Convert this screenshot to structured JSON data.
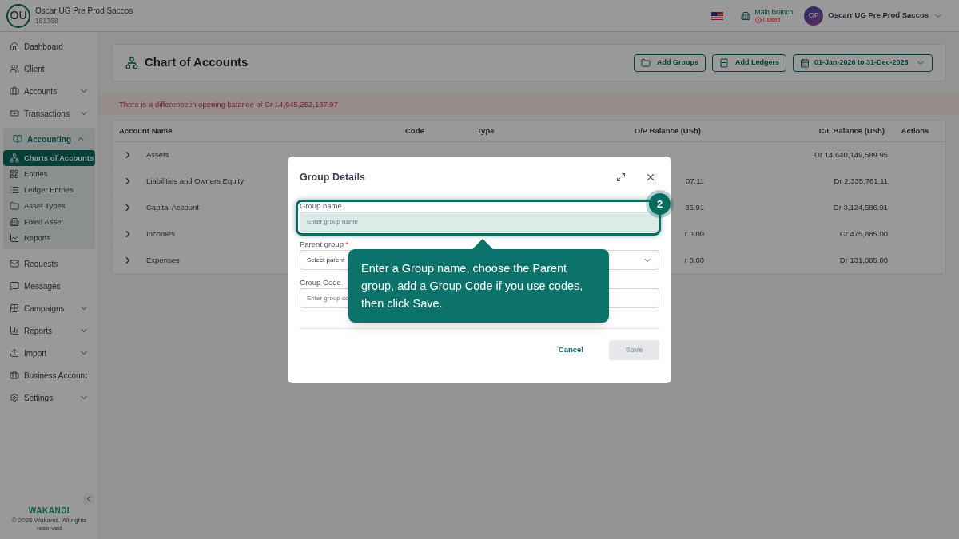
{
  "header": {
    "org_initials": "OU",
    "org_name": "Oscar UG Pre Prod Saccos",
    "org_id": "181368",
    "branch": "Main Branch",
    "branch_status": "Closed",
    "user_initials": "OP",
    "user_name": "Oscarr UG Pre Prod Saccos"
  },
  "sidebar": {
    "items": [
      {
        "label": "Dashboard",
        "expandable": false,
        "expanded": false
      },
      {
        "label": "Client",
        "expandable": false,
        "expanded": false
      },
      {
        "label": "Accounts",
        "expandable": true,
        "expanded": false
      },
      {
        "label": "Transactions",
        "expandable": true,
        "expanded": false
      },
      {
        "label": "Accounting",
        "expandable": true,
        "expanded": true,
        "children": [
          {
            "label": "Charts of Accounts",
            "selected": true
          },
          {
            "label": "Entries",
            "selected": false
          },
          {
            "label": "Ledger Entries",
            "selected": false
          },
          {
            "label": "Asset Types",
            "selected": false
          },
          {
            "label": "Fixed Asset",
            "selected": false
          },
          {
            "label": "Reports",
            "selected": false
          }
        ]
      },
      {
        "label": "Requests",
        "expandable": false,
        "expanded": false
      },
      {
        "label": "Messages",
        "expandable": false,
        "expanded": false
      },
      {
        "label": "Campaigns",
        "expandable": true,
        "expanded": false
      },
      {
        "label": "Reports",
        "expandable": true,
        "expanded": false
      },
      {
        "label": "Import",
        "expandable": true,
        "expanded": false
      },
      {
        "label": "Business Account",
        "expanded": false
      },
      {
        "label": "Settings",
        "expandable": true,
        "expanded": false
      }
    ],
    "brand": "WAKANDI",
    "copyright": "© 2026 Wakandi. All rights reserved"
  },
  "page": {
    "title": "Chart of Accounts",
    "buttons": [
      "Add Groups",
      "Add Ledgers"
    ],
    "date_range": "01-Jan-2026 to 31-Dec-2026",
    "alert": "There is a difference in opening balance of Cr 14,645,252,137.97"
  },
  "table": {
    "columns": [
      "Account Name",
      "Code",
      "Type",
      "O/P Balance (USh)",
      "C/L Balance (USh)",
      "Actions"
    ],
    "rows": [
      {
        "name": "Assets",
        "cl_balance": "Dr 14,640,149,589.95"
      },
      {
        "name": "Liabilities and Owners Equity",
        "op_balance": "07.11",
        "cl_balance": "Dr 2,335,761.11"
      },
      {
        "name": "Capital Account",
        "op_balance": "86.91",
        "cl_balance": "Dr 3,124,586.91"
      },
      {
        "name": "Incomes",
        "op_balance": "r 0.00",
        "cl_balance": "Cr 475,885.00"
      },
      {
        "name": "Expenses",
        "op_balance": "r 0.00",
        "cl_balance": "Dr 131,085.00"
      }
    ]
  },
  "dialog": {
    "title": "Group Details",
    "fields": [
      {
        "label": "Group name",
        "required": false,
        "kind": "text",
        "placeholder": "Enter group name",
        "highlighted": true
      },
      {
        "label": "Parent group",
        "required": true,
        "kind": "select",
        "placeholder": "Select parent",
        "highlighted": false
      },
      {
        "label": "Group Code",
        "required": false,
        "kind": "text",
        "placeholder": "Enter group co",
        "highlighted": false
      }
    ],
    "required_mark": "*",
    "cancel": "Cancel",
    "save": "Save",
    "save_disabled": true
  },
  "tour": {
    "step": "2",
    "text": "Enter a Group name, choose the Parent group, add a Group Code if you use codes, then click Save."
  }
}
